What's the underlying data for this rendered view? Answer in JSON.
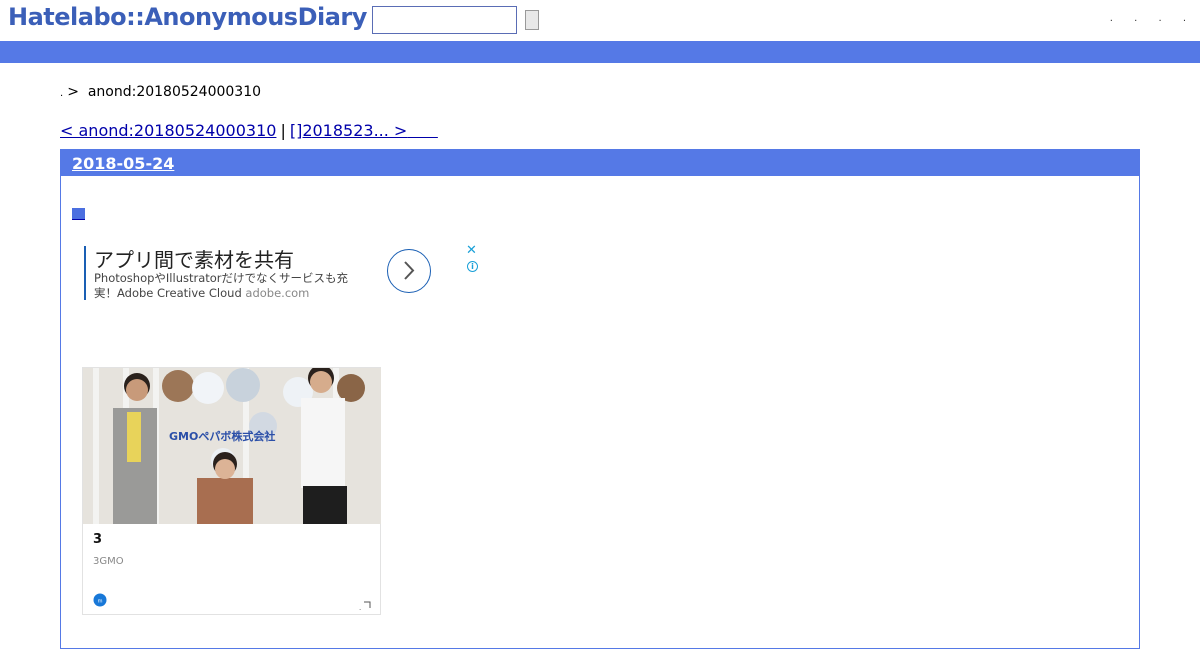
{
  "header": {
    "logo": "Hatelabo::AnonymousDiary",
    "search_value": "",
    "links": [
      ".",
      ".",
      ".",
      "."
    ]
  },
  "breadcrumb": {
    "dot": ".",
    "arrow": ">",
    "current": "anond:20180524000310"
  },
  "pager": {
    "prev": "< anond:20180524000310",
    "separator": "|",
    "next": "[]2018523... >"
  },
  "section": {
    "date": "2018-05-24"
  },
  "ad": {
    "title": "アプリ間で素材を共有",
    "body": "PhotoshopやIllustratorだけでなくサービスも充実！Adobe Creative Cloud",
    "domain": "adobe.com",
    "close": "✕",
    "info": "i"
  },
  "card": {
    "photo_sign": "GMOペパボ株式会社",
    "title": "3",
    "subtitle": "3GMO",
    "mark": "."
  },
  "colors": {
    "accent": "#5579e6",
    "logo": "#3b5fb8",
    "link": "#0000aa",
    "ad_blue": "#1a5fb4",
    "ad_cyan": "#1aa0d8"
  }
}
